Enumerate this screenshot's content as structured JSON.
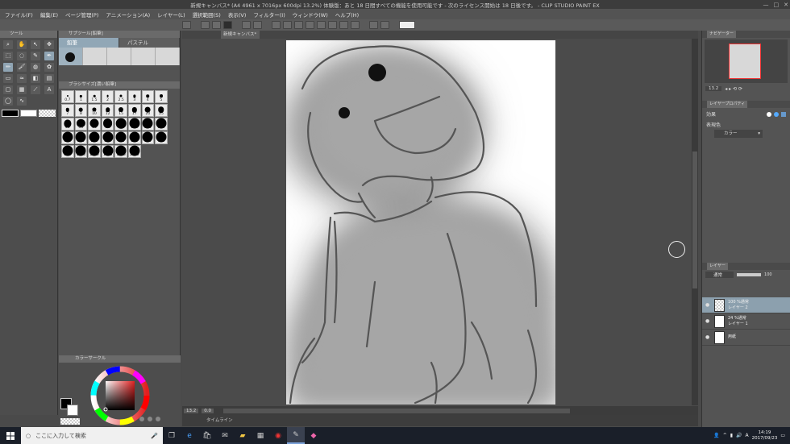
{
  "window": {
    "title": "新規キャンバス* (A4 4961 x 7016px 600dpi 13.2%)  体験版：あと 18 日間すべての機能を使用可能です - 次のライセンス開始は 18 日後です。 - CLIP STUDIO PAINT EX"
  },
  "menu": {
    "items": [
      "ファイル(F)",
      "編集(E)",
      "ページ管理(P)",
      "アニメーション(A)",
      "レイヤー(L)",
      "選択範囲(S)",
      "表示(V)",
      "フィルター(I)",
      "ウィンドウ(W)",
      "ヘルプ(H)"
    ]
  },
  "tool_panel": {
    "title": "ツール"
  },
  "subtool_panel": {
    "title": "サブツール[鉛筆]",
    "tabs": [
      "鉛筆",
      "パステル"
    ]
  },
  "brush_size_panel": {
    "title": "ブラシサイズ[濃い鉛筆]",
    "sizes": [
      "0.7",
      "1",
      "1.5",
      "2",
      "2.5",
      "3",
      "4",
      "5",
      "7",
      "8",
      "10",
      "12",
      "15",
      "17",
      "20",
      "25",
      "40",
      "50",
      "60",
      "70",
      "80",
      "100",
      "120",
      "150",
      "170",
      "200",
      "250",
      "300",
      "400",
      "500",
      "600",
      "700",
      "800",
      "1000",
      "1200",
      "1500",
      "1700",
      "2000"
    ]
  },
  "color_panel": {
    "title": "カラーサークル"
  },
  "canvas_tab": {
    "label": "新規キャンバス*"
  },
  "canvas_status": {
    "zoom": "13.2",
    "angle": "0.0"
  },
  "timeline": {
    "label": "タイムライン"
  },
  "right_panel": {
    "navigator_tab": "ナビゲーター",
    "navigator_zoom": "13.2",
    "layer_property_tab": "レイヤープロパティ",
    "effect_label": "効果",
    "expression_color_label": "表現色",
    "expression_color_value": "カラー",
    "layer_tab": "レイヤー",
    "blend_mode": "通常",
    "opacity": "100",
    "layers": [
      {
        "line1": "100 %通常",
        "line2": "レイヤー 2",
        "selected": true
      },
      {
        "line1": "24 %通常",
        "line2": "レイヤー 1",
        "selected": false
      },
      {
        "line1": "",
        "line2": "用紙",
        "selected": false
      }
    ]
  },
  "taskbar": {
    "search_placeholder": "ここに入力して検索",
    "time": "14:19",
    "date": "2017/09/23",
    "ime": "A"
  }
}
